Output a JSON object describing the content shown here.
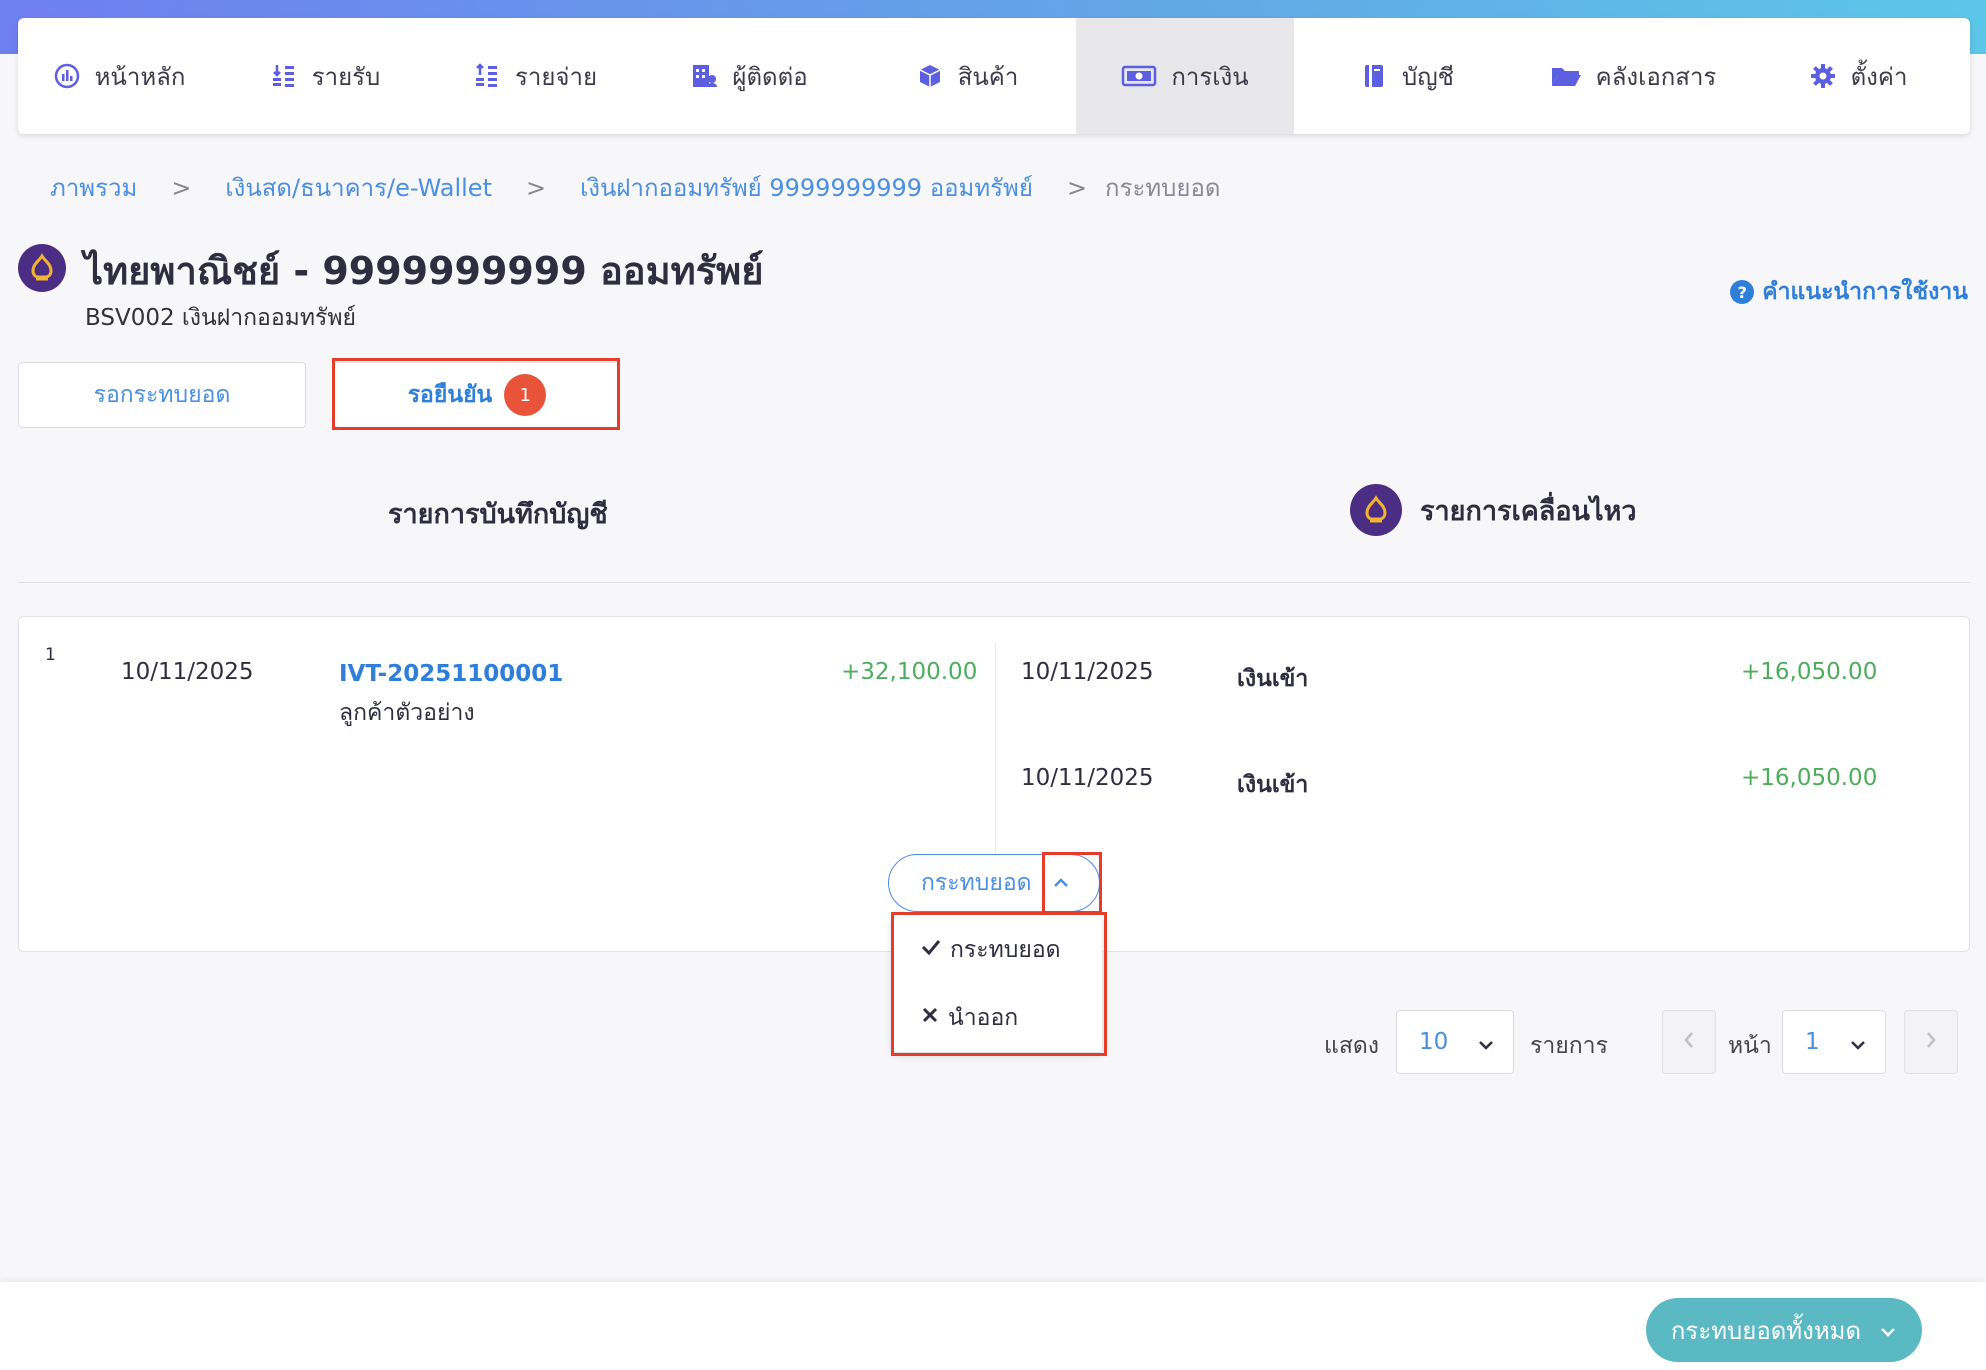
{
  "nav": {
    "items": [
      {
        "label": "หน้าหลัก",
        "icon": "dashboard-icon"
      },
      {
        "label": "รายรับ",
        "icon": "income-icon"
      },
      {
        "label": "รายจ่าย",
        "icon": "expense-icon"
      },
      {
        "label": "ผู้ติดต่อ",
        "icon": "contacts-icon"
      },
      {
        "label": "สินค้า",
        "icon": "box-icon"
      },
      {
        "label": "การเงิน",
        "icon": "money-icon"
      },
      {
        "label": "บัญชี",
        "icon": "ledger-icon"
      },
      {
        "label": "คลังเอกสาร",
        "icon": "folder-icon"
      },
      {
        "label": "ตั้งค่า",
        "icon": "gear-icon"
      }
    ],
    "active_index": 5
  },
  "breadcrumb": {
    "items": [
      "ภาพรวม",
      "เงินสด/ธนาคาร/e-Wallet",
      "เงินฝากออมทรัพย์ 9999999999 ออมทรัพย์"
    ],
    "separator": ">",
    "current": "กระทบยอด"
  },
  "header": {
    "title": "ไทยพาณิชย์ - 9999999999 ออมทรัพย์",
    "subtitle": "BSV002 เงินฝากออมทรัพย์",
    "help_label": "คำแนะนำการใช้งาน"
  },
  "tabs": {
    "pending_match": "รอกระทบยอด",
    "pending_confirm": "รอยืนยัน",
    "pending_confirm_count": "1"
  },
  "columns": {
    "book": "รายการบันทึกบัญชี",
    "bank": "รายการเคลื่อนไหว"
  },
  "row": {
    "index": "1",
    "book_date": "10/11/2025",
    "doc_no": "IVT-20251100001",
    "contact": "ลูกค้าตัวอย่าง",
    "book_amount": "+32,100.00",
    "movements": [
      {
        "date": "10/11/2025",
        "type": "เงินเข้า",
        "amount": "+16,050.00"
      },
      {
        "date": "10/11/2025",
        "type": "เงินเข้า",
        "amount": "+16,050.00"
      }
    ]
  },
  "match_button": {
    "label": "กระทบยอด",
    "menu": [
      {
        "label": "กระทบยอด",
        "icon": "check-icon"
      },
      {
        "label": "นำออก",
        "icon": "close-icon"
      }
    ]
  },
  "pagination": {
    "show_label": "แสดง",
    "page_size": "10",
    "items_label": "รายการ",
    "page_label": "หน้า",
    "page": "1"
  },
  "footer": {
    "match_all_label": "กระทบยอดทั้งหมด"
  },
  "colors": {
    "accent": "#4a8fe0",
    "positive": "#4cae5c",
    "badge": "#e8533a",
    "highlight_box": "#e53d2c",
    "match_all": "#5bb9c3",
    "bank_brand": "#4b2e83"
  }
}
